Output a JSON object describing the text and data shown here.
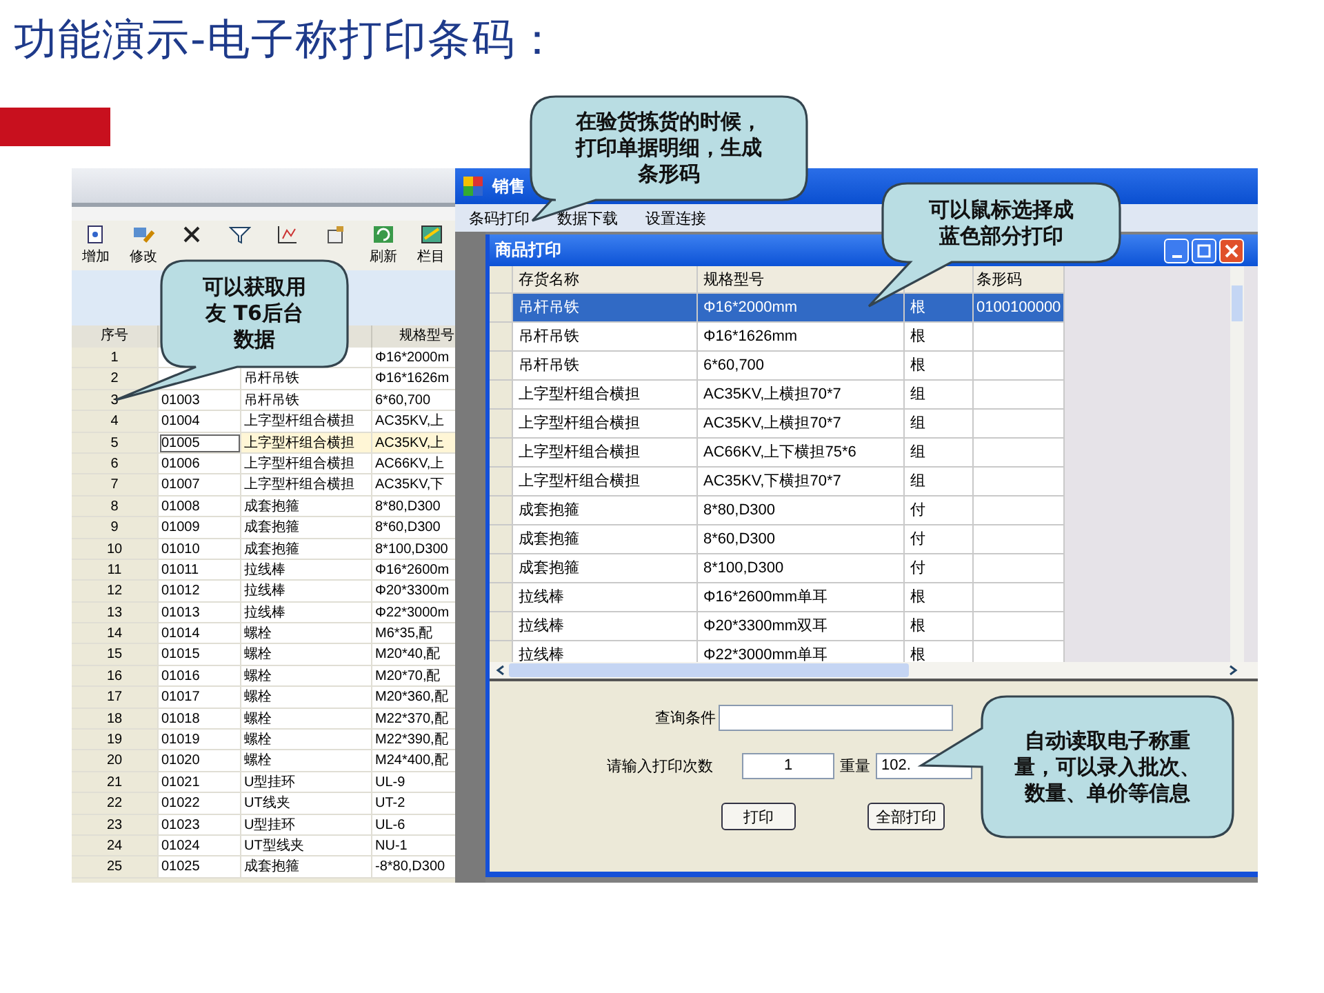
{
  "slide_title": "功能演示-电子称打印条码：",
  "left_window": {
    "toolbar": [
      {
        "kind": "labeled",
        "label": "增加"
      },
      {
        "kind": "labeled",
        "label": "修改"
      },
      {
        "kind": "icon_only"
      },
      {
        "kind": "icon_only"
      },
      {
        "kind": "icon_only"
      },
      {
        "kind": "icon_only"
      },
      {
        "kind": "labeled",
        "label": "刷新"
      },
      {
        "kind": "labeled",
        "label": "栏目"
      }
    ],
    "columns": [
      "序号",
      "",
      "",
      "规格型号"
    ],
    "rows": [
      {
        "seq": "1",
        "spec": "Φ16*2000m",
        "selected": false
      },
      {
        "seq": "2",
        "name": "吊杆吊铁",
        "spec": "Φ16*1626m",
        "selected": false
      },
      {
        "seq": "3",
        "code": "01003",
        "name": "吊杆吊铁",
        "spec": "6*60,700",
        "selected": false
      },
      {
        "seq": "4",
        "code": "01004",
        "name": "上字型杆组合横担",
        "spec": "AC35KV,上",
        "selected": false
      },
      {
        "seq": "5",
        "code": "01005",
        "name": "上字型杆组合横担",
        "spec": "AC35KV,上",
        "selected": true
      },
      {
        "seq": "6",
        "code": "01006",
        "name": "上字型杆组合横担",
        "spec": "AC66KV,上",
        "selected": false
      },
      {
        "seq": "7",
        "code": "01007",
        "name": "上字型杆组合横担",
        "spec": "AC35KV,下",
        "selected": false
      },
      {
        "seq": "8",
        "code": "01008",
        "name": "成套抱箍",
        "spec": "8*80,D300",
        "selected": false
      },
      {
        "seq": "9",
        "code": "01009",
        "name": "成套抱箍",
        "spec": "8*60,D300",
        "selected": false
      },
      {
        "seq": "10",
        "code": "01010",
        "name": "成套抱箍",
        "spec": "8*100,D300",
        "selected": false
      },
      {
        "seq": "11",
        "code": "01011",
        "name": "拉线棒",
        "spec": "Φ16*2600m",
        "selected": false
      },
      {
        "seq": "12",
        "code": "01012",
        "name": "拉线棒",
        "spec": "Φ20*3300m",
        "selected": false
      },
      {
        "seq": "13",
        "code": "01013",
        "name": "拉线棒",
        "spec": "Φ22*3000m",
        "selected": false
      },
      {
        "seq": "14",
        "code": "01014",
        "name": "螺栓",
        "spec": "M6*35,配",
        "selected": false
      },
      {
        "seq": "15",
        "code": "01015",
        "name": "螺栓",
        "spec": "M20*40,配",
        "selected": false
      },
      {
        "seq": "16",
        "code": "01016",
        "name": "螺栓",
        "spec": "M20*70,配",
        "selected": false
      },
      {
        "seq": "17",
        "code": "01017",
        "name": "螺栓",
        "spec": "M20*360,配",
        "selected": false
      },
      {
        "seq": "18",
        "code": "01018",
        "name": "螺栓",
        "spec": "M22*370,配",
        "selected": false
      },
      {
        "seq": "19",
        "code": "01019",
        "name": "螺栓",
        "spec": "M22*390,配",
        "selected": false
      },
      {
        "seq": "20",
        "code": "01020",
        "name": "螺栓",
        "spec": "M24*400,配",
        "selected": false
      },
      {
        "seq": "21",
        "code": "01021",
        "name": "U型挂环",
        "spec": "UL-9",
        "selected": false
      },
      {
        "seq": "22",
        "code": "01022",
        "name": "UT线夹",
        "spec": "UT-2",
        "selected": false
      },
      {
        "seq": "23",
        "code": "01023",
        "name": "U型挂环",
        "spec": "UL-6",
        "selected": false
      },
      {
        "seq": "24",
        "code": "01024",
        "name": "UT型线夹",
        "spec": "NU-1",
        "selected": false
      },
      {
        "seq": "25",
        "code": "01025",
        "name": "成套抱箍",
        "spec": "-8*80,D300",
        "selected": false
      }
    ]
  },
  "right_window": {
    "title": "销售",
    "menu": [
      "条码打印",
      "数据下载",
      "设置连接"
    ],
    "dialog": {
      "title": "商品打印",
      "columns": [
        "存货名称",
        "规格型号",
        "",
        "条形码"
      ],
      "rows": [
        {
          "name": "吊杆吊铁",
          "spec": "Φ16*2000mm",
          "unit": "根",
          "barcode": "0100100000",
          "selected": true
        },
        {
          "name": "吊杆吊铁",
          "spec": "Φ16*1626mm",
          "unit": "根",
          "selected": false
        },
        {
          "name": "吊杆吊铁",
          "spec": "6*60,700",
          "unit": "根",
          "selected": false
        },
        {
          "name": "上字型杆组合横担",
          "spec": "AC35KV,上横担70*7",
          "unit": "组",
          "selected": false
        },
        {
          "name": "上字型杆组合横担",
          "spec": "AC35KV,上横担70*7",
          "unit": "组",
          "selected": false
        },
        {
          "name": "上字型杆组合横担",
          "spec": "AC66KV,上下横担75*6",
          "unit": "组",
          "selected": false
        },
        {
          "name": "上字型杆组合横担",
          "spec": "AC35KV,下横担70*7",
          "unit": "组",
          "selected": false
        },
        {
          "name": "成套抱箍",
          "spec": "8*80,D300",
          "unit": "付",
          "selected": false
        },
        {
          "name": "成套抱箍",
          "spec": "8*60,D300",
          "unit": "付",
          "selected": false
        },
        {
          "name": "成套抱箍",
          "spec": "8*100,D300",
          "unit": "付",
          "selected": false
        },
        {
          "name": "拉线棒",
          "spec": "Φ16*2600mm单耳",
          "unit": "根",
          "selected": false
        },
        {
          "name": "拉线棒",
          "spec": "Φ20*3300mm双耳",
          "unit": "根",
          "selected": false
        },
        {
          "name": "拉线棒",
          "spec": "Φ22*3000mm单耳",
          "unit": "根",
          "selected": false
        }
      ],
      "query_label": "查询条件",
      "count_label": "请输入打印次数",
      "count_value": "1",
      "weight_label": "重量",
      "weight_value": "102.",
      "buttons": [
        "打印",
        "全部打印"
      ]
    }
  },
  "callouts": [
    "可以获取用友 T6后台数据",
    "在验货拣货的时候，打印单据明细，生成条形码",
    "可以鼠标选择成蓝色部分打印",
    "自动读取电子称重量，可以录入批次、数量、单价等信息"
  ]
}
